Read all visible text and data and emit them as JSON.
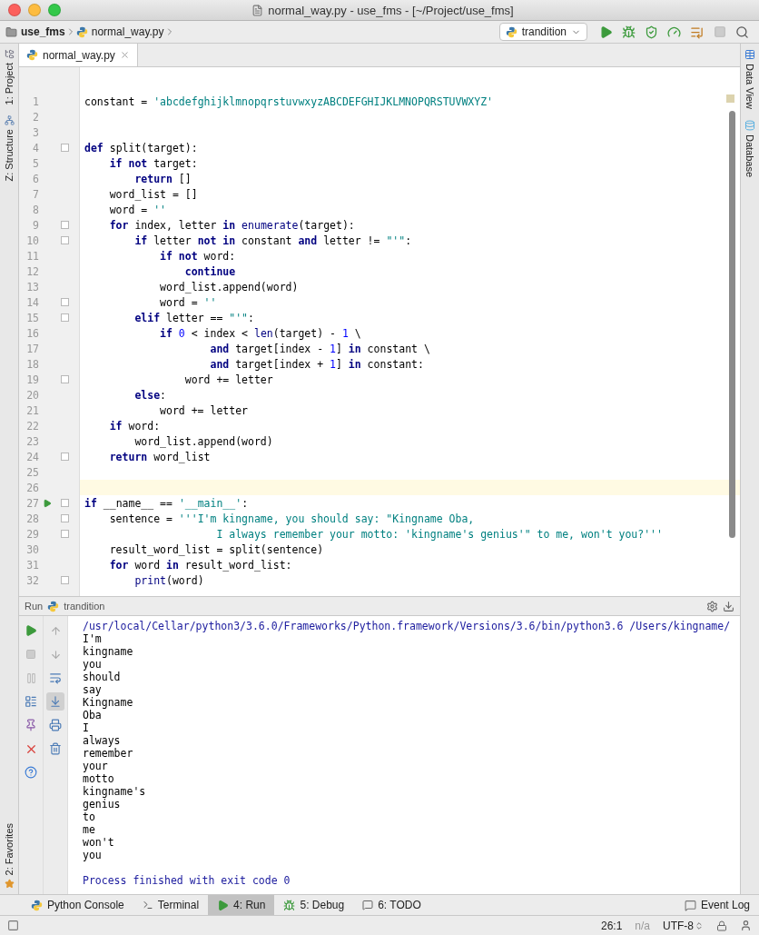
{
  "window": {
    "title": "normal_way.py - use_fms - [~/Project/use_fms]"
  },
  "breadcrumbs": [
    {
      "label": "use_fms",
      "kind": "folder"
    },
    {
      "label": "normal_way.py",
      "kind": "python"
    }
  ],
  "run_config": {
    "label": "trandition"
  },
  "editor_tabs": [
    {
      "label": "normal_way.py",
      "selected": true
    }
  ],
  "left_tool_windows": [
    {
      "label": "1: Project",
      "kind": "project"
    },
    {
      "label": "Z: Structure",
      "kind": "structure"
    }
  ],
  "left_bottom_tool_windows": [
    {
      "label": "2: Favorites",
      "kind": "favorites"
    }
  ],
  "right_tool_windows": [
    {
      "label": "Data View",
      "kind": "table"
    },
    {
      "label": "Database",
      "kind": "database"
    }
  ],
  "code_lines": [
    {
      "n": "1",
      "fold": false,
      "current": false,
      "run": false,
      "tokens": [
        {
          "kind": "plain",
          "text": "constant = "
        },
        {
          "kind": "string",
          "text": "'abcdefghijklmnopqrstuvwxyzABCDEFGHIJKLMNOPQRSTUVWXYZ'"
        }
      ]
    },
    {
      "n": "2",
      "fold": false,
      "current": false,
      "run": false
    },
    {
      "n": "3",
      "fold": false,
      "current": false,
      "run": false
    },
    {
      "n": "4",
      "fold": true,
      "current": false,
      "run": false,
      "tokens": [
        {
          "kind": "keyword",
          "text": "def"
        },
        {
          "kind": "plain",
          "text": " split(target):"
        }
      ]
    },
    {
      "n": "5",
      "fold": false,
      "current": false,
      "run": false,
      "tokens": [
        {
          "kind": "keyword",
          "text": "    if not"
        },
        {
          "kind": "plain",
          "text": " target:"
        }
      ]
    },
    {
      "n": "6",
      "fold": false,
      "current": false,
      "run": false,
      "tokens": [
        {
          "kind": "keyword",
          "text": "        return"
        },
        {
          "kind": "plain",
          "text": " []"
        }
      ]
    },
    {
      "n": "7",
      "fold": false,
      "current": false,
      "run": false,
      "tokens": [
        {
          "kind": "plain",
          "text": "    word_list = []"
        }
      ]
    },
    {
      "n": "8",
      "fold": false,
      "current": false,
      "run": false,
      "tokens": [
        {
          "kind": "plain",
          "text": "    word = "
        },
        {
          "kind": "string",
          "text": "''"
        }
      ]
    },
    {
      "n": "9",
      "fold": true,
      "current": false,
      "run": false,
      "tokens": [
        {
          "kind": "keyword",
          "text": "    for"
        },
        {
          "kind": "plain",
          "text": " index, letter "
        },
        {
          "kind": "keyword",
          "text": "in"
        },
        {
          "kind": "builtin",
          "text": " enumerate"
        },
        {
          "kind": "plain",
          "text": "(target):"
        }
      ]
    },
    {
      "n": "10",
      "fold": true,
      "current": false,
      "run": false,
      "tokens": [
        {
          "kind": "keyword",
          "text": "        if"
        },
        {
          "kind": "plain",
          "text": " letter "
        },
        {
          "kind": "keyword",
          "text": "not in"
        },
        {
          "kind": "plain",
          "text": " constant "
        },
        {
          "kind": "keyword",
          "text": "and"
        },
        {
          "kind": "plain",
          "text": " letter != "
        },
        {
          "kind": "string",
          "text": "\"'\""
        },
        {
          "kind": "plain",
          "text": ":"
        }
      ]
    },
    {
      "n": "11",
      "fold": false,
      "current": false,
      "run": false,
      "tokens": [
        {
          "kind": "keyword",
          "text": "            if not"
        },
        {
          "kind": "plain",
          "text": " word:"
        }
      ]
    },
    {
      "n": "12",
      "fold": false,
      "current": false,
      "run": false,
      "tokens": [
        {
          "kind": "keyword",
          "text": "                continue"
        }
      ]
    },
    {
      "n": "13",
      "fold": false,
      "current": false,
      "run": false,
      "tokens": [
        {
          "kind": "plain",
          "text": "            word_list.append(word)"
        }
      ]
    },
    {
      "n": "14",
      "fold": true,
      "current": false,
      "run": false,
      "tokens": [
        {
          "kind": "plain",
          "text": "            word = "
        },
        {
          "kind": "string",
          "text": "''"
        }
      ]
    },
    {
      "n": "15",
      "fold": true,
      "current": false,
      "run": false,
      "tokens": [
        {
          "kind": "keyword",
          "text": "        elif"
        },
        {
          "kind": "plain",
          "text": " letter == "
        },
        {
          "kind": "string",
          "text": "\"'\""
        },
        {
          "kind": "plain",
          "text": ":"
        }
      ]
    },
    {
      "n": "16",
      "fold": false,
      "current": false,
      "run": false,
      "tokens": [
        {
          "kind": "keyword",
          "text": "            if"
        },
        {
          "kind": "number",
          "text": " 0"
        },
        {
          "kind": "plain",
          "text": " < index < "
        },
        {
          "kind": "builtin",
          "text": "len"
        },
        {
          "kind": "plain",
          "text": "(target) - "
        },
        {
          "kind": "number",
          "text": "1"
        },
        {
          "kind": "plain",
          "text": " \\"
        }
      ]
    },
    {
      "n": "17",
      "fold": false,
      "current": false,
      "run": false,
      "tokens": [
        {
          "kind": "keyword",
          "text": "                    and"
        },
        {
          "kind": "plain",
          "text": " target[index - "
        },
        {
          "kind": "number",
          "text": "1"
        },
        {
          "kind": "plain",
          "text": "] "
        },
        {
          "kind": "keyword",
          "text": "in"
        },
        {
          "kind": "plain",
          "text": " constant \\"
        }
      ]
    },
    {
      "n": "18",
      "fold": false,
      "current": false,
      "run": false,
      "tokens": [
        {
          "kind": "keyword",
          "text": "                    and"
        },
        {
          "kind": "plain",
          "text": " target[index + "
        },
        {
          "kind": "number",
          "text": "1"
        },
        {
          "kind": "plain",
          "text": "] "
        },
        {
          "kind": "keyword",
          "text": "in"
        },
        {
          "kind": "plain",
          "text": " constant:"
        }
      ]
    },
    {
      "n": "19",
      "fold": true,
      "current": false,
      "run": false,
      "tokens": [
        {
          "kind": "plain",
          "text": "                word += letter"
        }
      ]
    },
    {
      "n": "20",
      "fold": false,
      "current": false,
      "run": false,
      "tokens": [
        {
          "kind": "keyword",
          "text": "        else"
        },
        {
          "kind": "plain",
          "text": ":"
        }
      ]
    },
    {
      "n": "21",
      "fold": false,
      "current": false,
      "run": false,
      "tokens": [
        {
          "kind": "plain",
          "text": "            word += letter"
        }
      ]
    },
    {
      "n": "22",
      "fold": false,
      "current": false,
      "run": false,
      "tokens": [
        {
          "kind": "keyword",
          "text": "    if"
        },
        {
          "kind": "plain",
          "text": " word:"
        }
      ]
    },
    {
      "n": "23",
      "fold": false,
      "current": false,
      "run": false,
      "tokens": [
        {
          "kind": "plain",
          "text": "        word_list.append(word)"
        }
      ]
    },
    {
      "n": "24",
      "fold": true,
      "current": false,
      "run": false,
      "tokens": [
        {
          "kind": "keyword",
          "text": "    return"
        },
        {
          "kind": "plain",
          "text": " word_list"
        }
      ]
    },
    {
      "n": "25",
      "fold": false,
      "current": false,
      "run": false
    },
    {
      "n": "26",
      "fold": false,
      "current": true,
      "run": false
    },
    {
      "n": "27",
      "fold": true,
      "current": false,
      "run": true,
      "tokens": [
        {
          "kind": "keyword",
          "text": "if"
        },
        {
          "kind": "plain",
          "text": " __name__ == "
        },
        {
          "kind": "string",
          "text": "'__main__'"
        },
        {
          "kind": "plain",
          "text": ":"
        }
      ]
    },
    {
      "n": "28",
      "fold": true,
      "current": false,
      "run": false,
      "tokens": [
        {
          "kind": "plain",
          "text": "    sentence = "
        },
        {
          "kind": "string",
          "text": "'''I'm kingname, you should say: \"Kingname Oba,"
        }
      ]
    },
    {
      "n": "29",
      "fold": true,
      "current": false,
      "run": false,
      "tokens": [
        {
          "kind": "string",
          "text": "                     I always remember your motto: 'kingname's genius'\" to me, won't you?'''"
        }
      ]
    },
    {
      "n": "30",
      "fold": false,
      "current": false,
      "run": false,
      "tokens": [
        {
          "kind": "plain",
          "text": "    result_word_list = split(sentence)"
        }
      ]
    },
    {
      "n": "31",
      "fold": false,
      "current": false,
      "run": false,
      "tokens": [
        {
          "kind": "keyword",
          "text": "    for"
        },
        {
          "kind": "plain",
          "text": " word "
        },
        {
          "kind": "keyword",
          "text": "in"
        },
        {
          "kind": "plain",
          "text": " result_word_list:"
        }
      ]
    },
    {
      "n": "32",
      "fold": true,
      "current": false,
      "run": false,
      "tokens": [
        {
          "kind": "builtin",
          "text": "        print"
        },
        {
          "kind": "plain",
          "text": "(word)"
        }
      ]
    }
  ],
  "run_panel": {
    "title": "Run",
    "config": "trandition",
    "output": [
      {
        "kind": "command",
        "text": "/usr/local/Cellar/python3/3.6.0/Frameworks/Python.framework/Versions/3.6/bin/python3.6 /Users/kingname/"
      },
      {
        "kind": "out",
        "text": "I'm"
      },
      {
        "kind": "out",
        "text": "kingname"
      },
      {
        "kind": "out",
        "text": "you"
      },
      {
        "kind": "out",
        "text": "should"
      },
      {
        "kind": "out",
        "text": "say"
      },
      {
        "kind": "out",
        "text": "Kingname"
      },
      {
        "kind": "out",
        "text": "Oba"
      },
      {
        "kind": "out",
        "text": "I"
      },
      {
        "kind": "out",
        "text": "always"
      },
      {
        "kind": "out",
        "text": "remember"
      },
      {
        "kind": "out",
        "text": "your"
      },
      {
        "kind": "out",
        "text": "motto"
      },
      {
        "kind": "out",
        "text": "kingname's"
      },
      {
        "kind": "out",
        "text": "genius"
      },
      {
        "kind": "out",
        "text": "to"
      },
      {
        "kind": "out",
        "text": "me"
      },
      {
        "kind": "out",
        "text": "won't"
      },
      {
        "kind": "out",
        "text": "you"
      },
      {
        "kind": "exit",
        "text": "Process finished with exit code 0"
      }
    ]
  },
  "bottom_tools": [
    {
      "label": "Python Console",
      "kind": "python",
      "selected": false
    },
    {
      "label": "Terminal",
      "kind": "terminal",
      "selected": false
    },
    {
      "label": "4: Run",
      "kind": "run",
      "selected": true
    },
    {
      "label": "5: Debug",
      "kind": "debug",
      "selected": false
    },
    {
      "label": "6: TODO",
      "kind": "todo",
      "selected": false
    }
  ],
  "event_log": {
    "label": "Event Log"
  },
  "status_bar": {
    "position": "26:1",
    "na": "n/a",
    "encoding": "UTF-8"
  }
}
